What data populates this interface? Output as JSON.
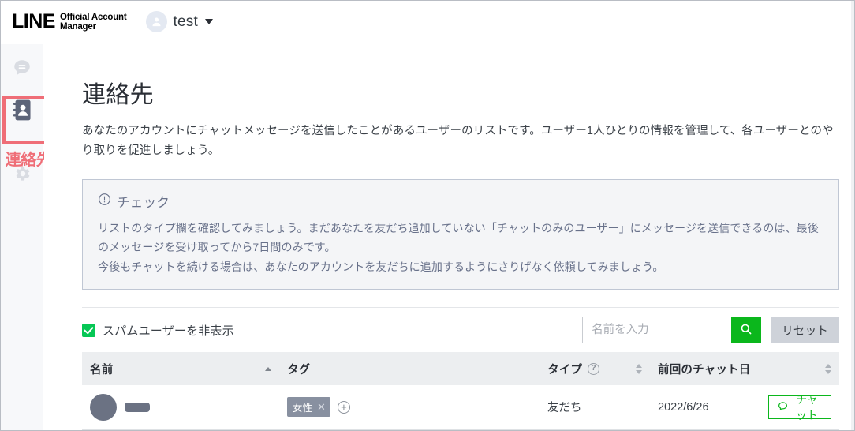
{
  "header": {
    "brand_main": "LINE",
    "brand_line1": "Official Account",
    "brand_line2": "Manager",
    "avatar_icon": "person-icon",
    "account_name": "test",
    "caret_icon": "caret-down-icon"
  },
  "sidebar": {
    "items": [
      {
        "name": "chat",
        "icon": "chat-bubble-icon",
        "label": ""
      },
      {
        "name": "contacts",
        "icon": "contact-book-icon",
        "label": ""
      },
      {
        "name": "settings",
        "icon": "gear-icon",
        "label": ""
      }
    ]
  },
  "annotation": {
    "label": "連絡先",
    "color": "#ef6e77"
  },
  "main": {
    "title": "連絡先",
    "description": "あなたのアカウントにチャットメッセージを送信したことがあるユーザーのリストです。ユーザー1人ひとりの情報を管理して、各ユーザーとのやり取りを促進しましょう。",
    "notice": {
      "icon": "exclamation-circle-icon",
      "title": "チェック",
      "line1": "リストのタイプ欄を確認してみましょう。まだあなたを友だち追加していない「チャットのみのユーザー」にメッセージを送信できるのは、最後のメッセージを受け取ってから7日間のみです。",
      "line2": "今後もチャットを続ける場合は、あなたのアカウントを友だちに追加するようにさりげなく依頼してみましょう。"
    },
    "filter": {
      "spam_checkbox_label": "スパムユーザーを非表示",
      "spam_checkbox_checked": true,
      "search_placeholder": "名前を入力",
      "search_value": "",
      "search_icon": "search-icon",
      "reset_label": "リセット"
    },
    "table": {
      "columns": [
        {
          "label": "名前",
          "sort": "asc"
        },
        {
          "label": "タグ",
          "sort": "none"
        },
        {
          "label": "タイプ",
          "sort": "both",
          "help": "?"
        },
        {
          "label": "前回のチャット日",
          "sort": "both"
        },
        {
          "label": "",
          "sort": "none"
        }
      ],
      "rows": [
        {
          "avatar": "user-avatar",
          "name": "",
          "tag": "女性",
          "tag_remove_icon": "close-icon",
          "tag_add_icon": "plus-circle-icon",
          "type": "友だち",
          "last_chat": "2022/6/26",
          "action_label": "チャット",
          "action_icon": "chat-bubble-icon"
        }
      ]
    }
  },
  "colors": {
    "brand_green": "#06c755",
    "search_green": "#0bb71c",
    "annotation_red": "#ef6e77",
    "notice_bg": "#f4f5f7",
    "table_header_bg": "#eceef0"
  }
}
